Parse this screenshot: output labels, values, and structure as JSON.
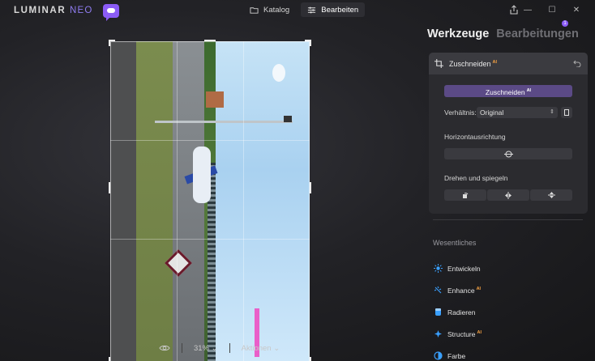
{
  "app": {
    "logo_main": "LUMINAR",
    "logo_neo": "NEO"
  },
  "topnav": {
    "katalog_label": "Katalog",
    "bearbeiten_label": "Bearbeiten",
    "active": "Bearbeiten"
  },
  "window_controls": [
    "share-icon",
    "minimize-icon",
    "maximize-icon",
    "close-icon"
  ],
  "panel": {
    "tab_tools": "Werkzeuge",
    "tab_edits": "Bearbeitungen",
    "edits_badge": "1"
  },
  "crop_tool": {
    "title": "Zuschneiden",
    "ai_badge": "AI",
    "crop_button": "Zuschneiden",
    "ratio_label": "Verhältnis:",
    "ratio_value": "Original",
    "horizon_label": "Horizontausrichtung",
    "rotate_label": "Drehen und spiegeln",
    "rotate_buttons": [
      "rotate-icon",
      "flip-horizontal-icon",
      "flip-vertical-icon"
    ]
  },
  "essentials": {
    "section_title": "Wesentliches",
    "items": [
      {
        "label": "Entwickeln",
        "ai": "",
        "icon": "sun-icon"
      },
      {
        "label": "Enhance",
        "ai": "AI",
        "icon": "sparkle-icon"
      },
      {
        "label": "Radieren",
        "ai": "",
        "icon": "eraser-icon"
      },
      {
        "label": "Structure",
        "ai": "AI",
        "icon": "structure-icon"
      },
      {
        "label": "Farbe",
        "ai": "",
        "icon": "color-icon"
      }
    ]
  },
  "bottombar": {
    "zoom": "31%",
    "actions": "Aktionen"
  },
  "colors": {
    "accent": "#8b5cf6",
    "crop_button": "#5b4a86",
    "ai_badge": "#f5a142",
    "tool_icon": "#3aa0ff"
  }
}
